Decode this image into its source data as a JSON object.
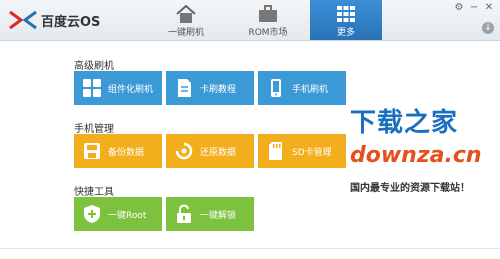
{
  "app": {
    "title": "百度云OS"
  },
  "nav": {
    "tabs": [
      {
        "label": "一键刷机",
        "icon": "home-icon"
      },
      {
        "label": "ROM市场",
        "icon": "briefcase-icon"
      },
      {
        "label": "更多",
        "icon": "grid-icon",
        "active": true
      }
    ]
  },
  "sections": [
    {
      "title": "高级刷机",
      "tiles": [
        {
          "label": "组件化刷机",
          "icon": "components-icon",
          "color": "#3b9ad6"
        },
        {
          "label": "卡刷教程",
          "icon": "document-icon",
          "color": "#3b9ad6"
        },
        {
          "label": "手机刷机",
          "icon": "phone-icon",
          "color": "#3b9ad6"
        }
      ]
    },
    {
      "title": "手机管理",
      "tiles": [
        {
          "label": "备份数据",
          "icon": "backup-icon",
          "color": "#f2ae1c"
        },
        {
          "label": "还原数据",
          "icon": "restore-icon",
          "color": "#f2ae1c"
        },
        {
          "label": "SD卡管理",
          "icon": "sdcard-icon",
          "color": "#f2ae1c"
        }
      ]
    },
    {
      "title": "快捷工具",
      "tiles": [
        {
          "label": "一键Root",
          "icon": "shield-icon",
          "color": "#7cc23e"
        },
        {
          "label": "一键解锁",
          "icon": "unlock-icon",
          "color": "#7cc23e"
        }
      ]
    }
  ],
  "watermark": {
    "line1": "下载之家",
    "line2": "downza.cn",
    "line3": "国内最专业的资源下载站！"
  }
}
